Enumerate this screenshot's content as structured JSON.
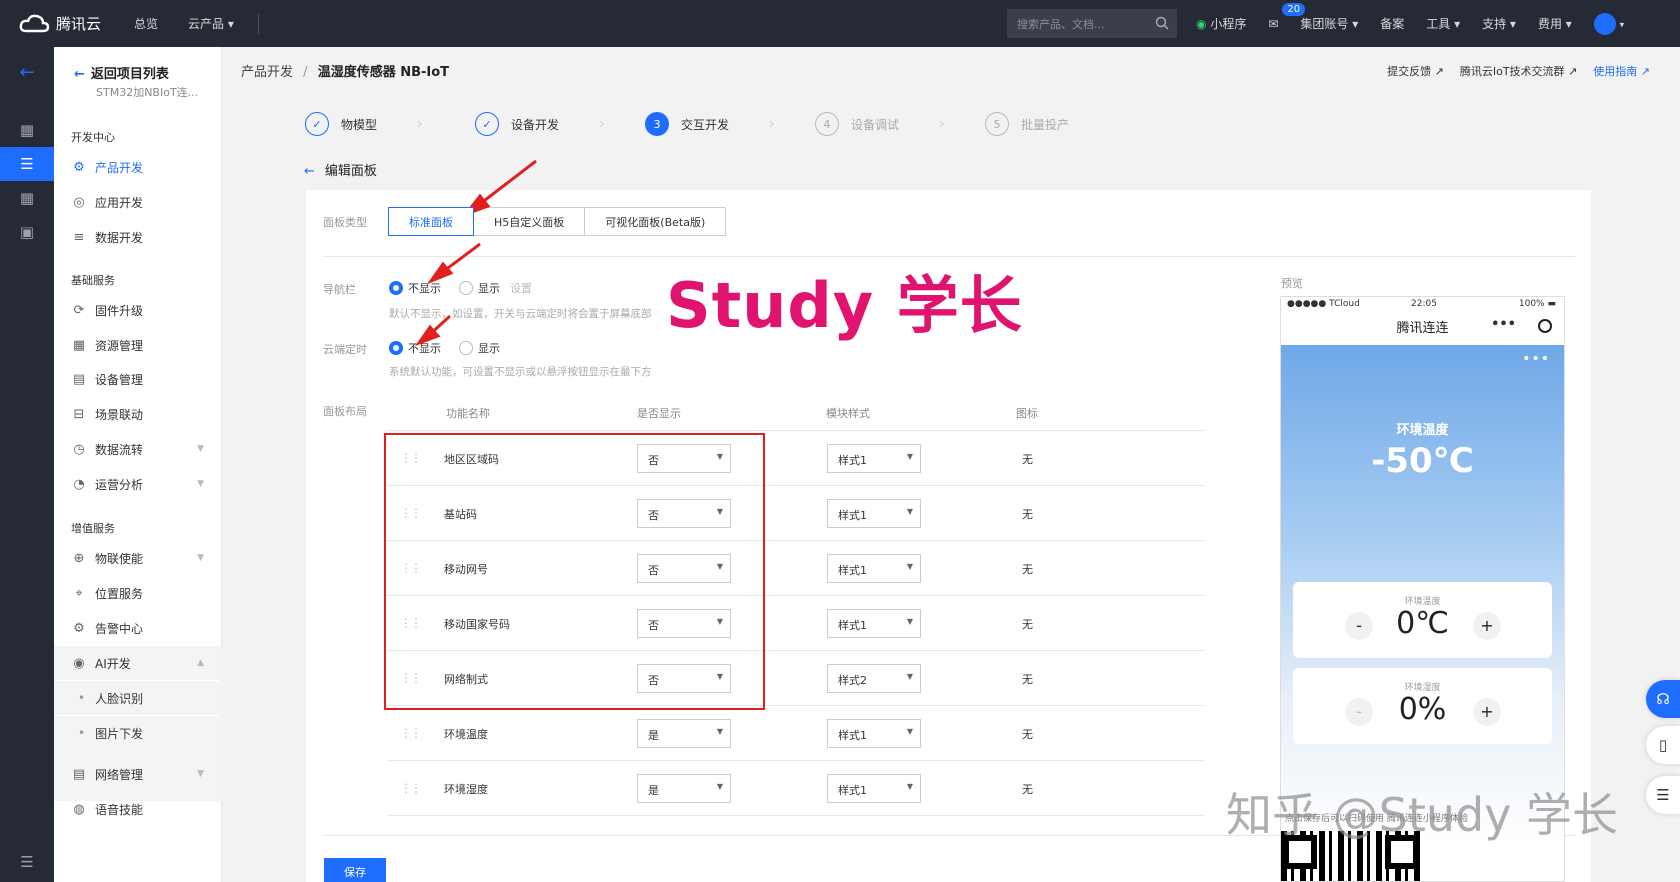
{
  "topnav": {
    "brand": "腾讯云",
    "overview": "总览",
    "products": "云产品 ▾",
    "search_placeholder": "搜索产品、文档...",
    "miniprogram": "小程序",
    "mail_badge": "20",
    "group_account": "集团账号 ▾",
    "record": "备案",
    "tools": "工具 ▾",
    "support": "支持 ▾",
    "billing": "费用 ▾"
  },
  "sidebar": {
    "back": "返回项目列表",
    "project_sub": "STM32加NBIoT连...",
    "sec_dev": "开发中心",
    "product_dev": "产品开发",
    "app_dev": "应用开发",
    "data_dev": "数据开发",
    "sec_basic": "基础服务",
    "firmware": "固件升级",
    "resource": "资源管理",
    "device_mgmt": "设备管理",
    "scene": "场景联动",
    "dataflow": "数据流转",
    "ops": "运营分析",
    "sec_value": "增值服务",
    "iot_card": "物联使能",
    "location": "位置服务",
    "alarm": "告警中心",
    "ai": "AI开发",
    "face": "人脸识别",
    "image": "图片下发",
    "network": "网络管理",
    "voice": "语音技能"
  },
  "breadcrumb": {
    "root": "产品开发",
    "sep": "/",
    "current": "温湿度传感器 NB-IoT"
  },
  "toplinks": {
    "feedback": "提交反馈",
    "group": "腾讯云IoT技术交流群",
    "guide": "使用指南"
  },
  "steps": [
    {
      "label": "物模型",
      "mark": "✓"
    },
    {
      "label": "设备开发",
      "mark": "✓"
    },
    {
      "label": "交互开发",
      "mark": "3"
    },
    {
      "label": "设备调试",
      "mark": "4"
    },
    {
      "label": "批量投产",
      "mark": "5"
    }
  ],
  "edit_back": "编辑面板",
  "panel": {
    "type_label": "面板类型",
    "tabs": [
      "标准面板",
      "H5自定义面板",
      "可视化面板(Beta版)"
    ],
    "nav_label": "导航栏",
    "nav_hide": "不显示",
    "nav_show": "显示",
    "nav_set": "设置",
    "nav_hint": "默认不显示，如设置，开关与云端定时将会置于屏幕底部",
    "timer_label": "云端定时",
    "timer_hide": "不显示",
    "timer_show": "显示",
    "timer_hint": "系统默认功能，可设置不显示或以悬浮按钮显示在最下方",
    "layout_label": "面板布局",
    "headers": {
      "name": "功能名称",
      "show": "是否显示",
      "style": "模块样式",
      "icon": "图标"
    },
    "rows": [
      {
        "name": "地区区域码",
        "show": "否",
        "style": "样式1",
        "icon": "无"
      },
      {
        "name": "基站码",
        "show": "否",
        "style": "样式1",
        "icon": "无"
      },
      {
        "name": "移动网号",
        "show": "否",
        "style": "样式1",
        "icon": "无"
      },
      {
        "name": "移动国家号码",
        "show": "否",
        "style": "样式1",
        "icon": "无"
      },
      {
        "name": "网络制式",
        "show": "否",
        "style": "样式2",
        "icon": "无"
      },
      {
        "name": "环境温度",
        "show": "是",
        "style": "样式1",
        "icon": "无"
      },
      {
        "name": "环境湿度",
        "show": "是",
        "style": "样式1",
        "icon": "无"
      }
    ],
    "save": "保存"
  },
  "preview": {
    "label": "预览",
    "carrier": "●●●●● TCloud",
    "time": "22:05",
    "battery": "100%",
    "title": "腾讯连连",
    "dots": "•••",
    "more": "•••",
    "hero_label": "环境温度",
    "hero_value": "-50℃",
    "card1_label": "环境温度",
    "card1_value": "0℃",
    "card2_label": "环境湿度",
    "card2_value": "0%",
    "minus": "-",
    "plus": "+",
    "foot": "点击保存后可以扫码使用 腾讯连连小程序体验"
  },
  "watermark": "Study 学长",
  "watermark2": "知乎 @Study 学长"
}
